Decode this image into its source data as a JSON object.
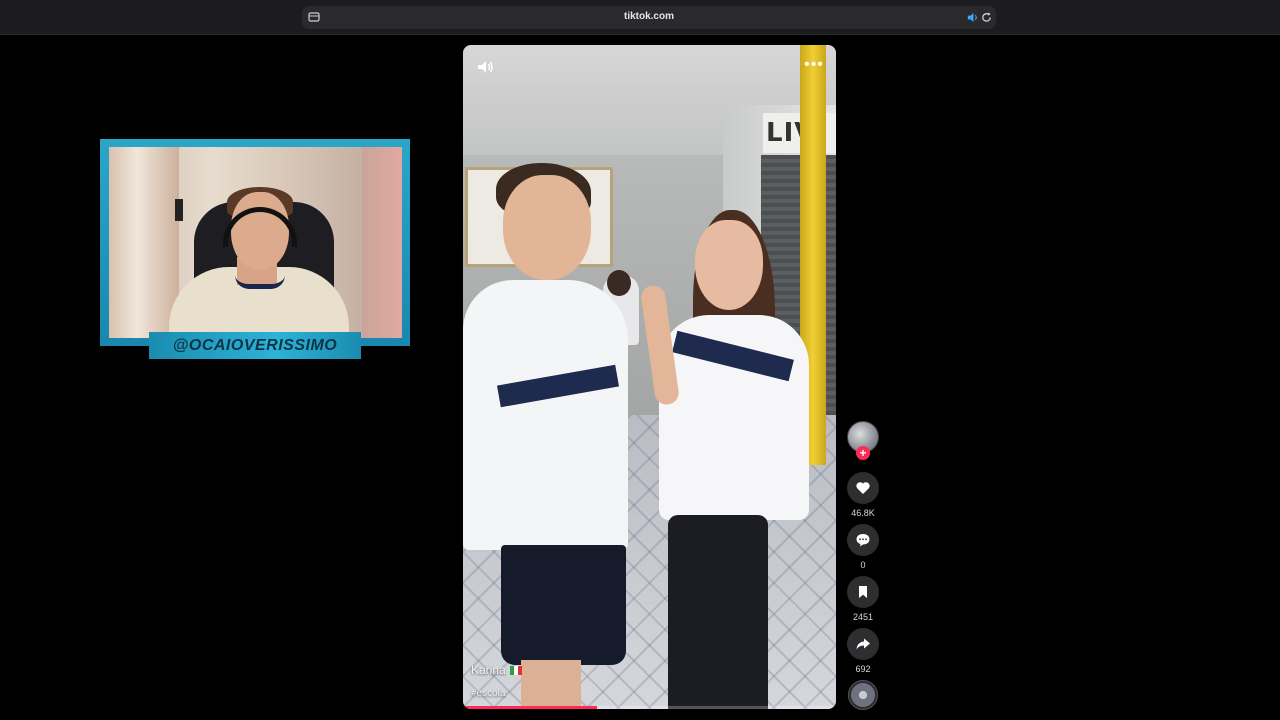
{
  "browser": {
    "url": "tiktok.com"
  },
  "webcam": {
    "handle": "@OCAIOVERISSIMO"
  },
  "video": {
    "author": "Karina",
    "hashtag": "#escola",
    "sign_text": "LIV",
    "progress_fraction": 0.36
  },
  "actions": {
    "likes": "46.8K",
    "comments": "0",
    "saves": "2451",
    "shares": "692"
  },
  "icons": {
    "site": "sidebar-icon",
    "audio": "speaker-icon",
    "reload": "reload-icon",
    "mute": "volume-icon",
    "more": "more-icon",
    "like": "heart-icon",
    "comment": "comment-icon",
    "save": "bookmark-icon",
    "share": "share-icon",
    "follow": "plus-icon"
  },
  "colors": {
    "accent": "#fe2c55",
    "webcam_frame": "#2aa6c9"
  }
}
